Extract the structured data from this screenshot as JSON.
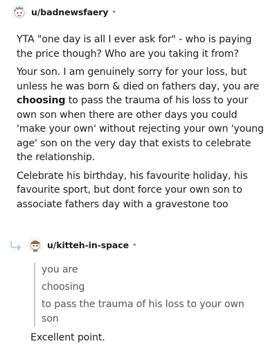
{
  "comment_1": {
    "username": "u/badnewsfaery",
    "separator": "•",
    "paragraphs": [
      {
        "text": "YTA \"one day is all I ever ask for\" - who is paying the price though? Who are you taking it from?"
      },
      {
        "before": "Your son. I am genuinely sorry for your loss, but unless he was born & died on fathers day, you are ",
        "bold": "choosing",
        "after": " to pass the trauma of his loss to your own son when there are other days you could 'make your own' without rejecting your own 'young age' son on the very day that exists to celebrate the relationship."
      },
      {
        "text": "Celebrate his birthday, his favourite holiday, his favourite sport, but dont force your own son to associate fathers day with a gravestone too"
      }
    ]
  },
  "comment_2": {
    "username": "u/kitteh-in-space",
    "separator": "•",
    "quote": [
      "you are",
      "choosing",
      "to pass the trauma of his loss to your own son"
    ],
    "reply": "Excellent point."
  },
  "colors": {
    "text": "#1c1c1c",
    "muted": "#7c7c7c",
    "quote_border": "#c8c8c8"
  },
  "icons": {
    "reply": "reply-arrow-icon",
    "avatar_1": "snoo-avatar",
    "avatar_2": "snoo-avatar"
  }
}
